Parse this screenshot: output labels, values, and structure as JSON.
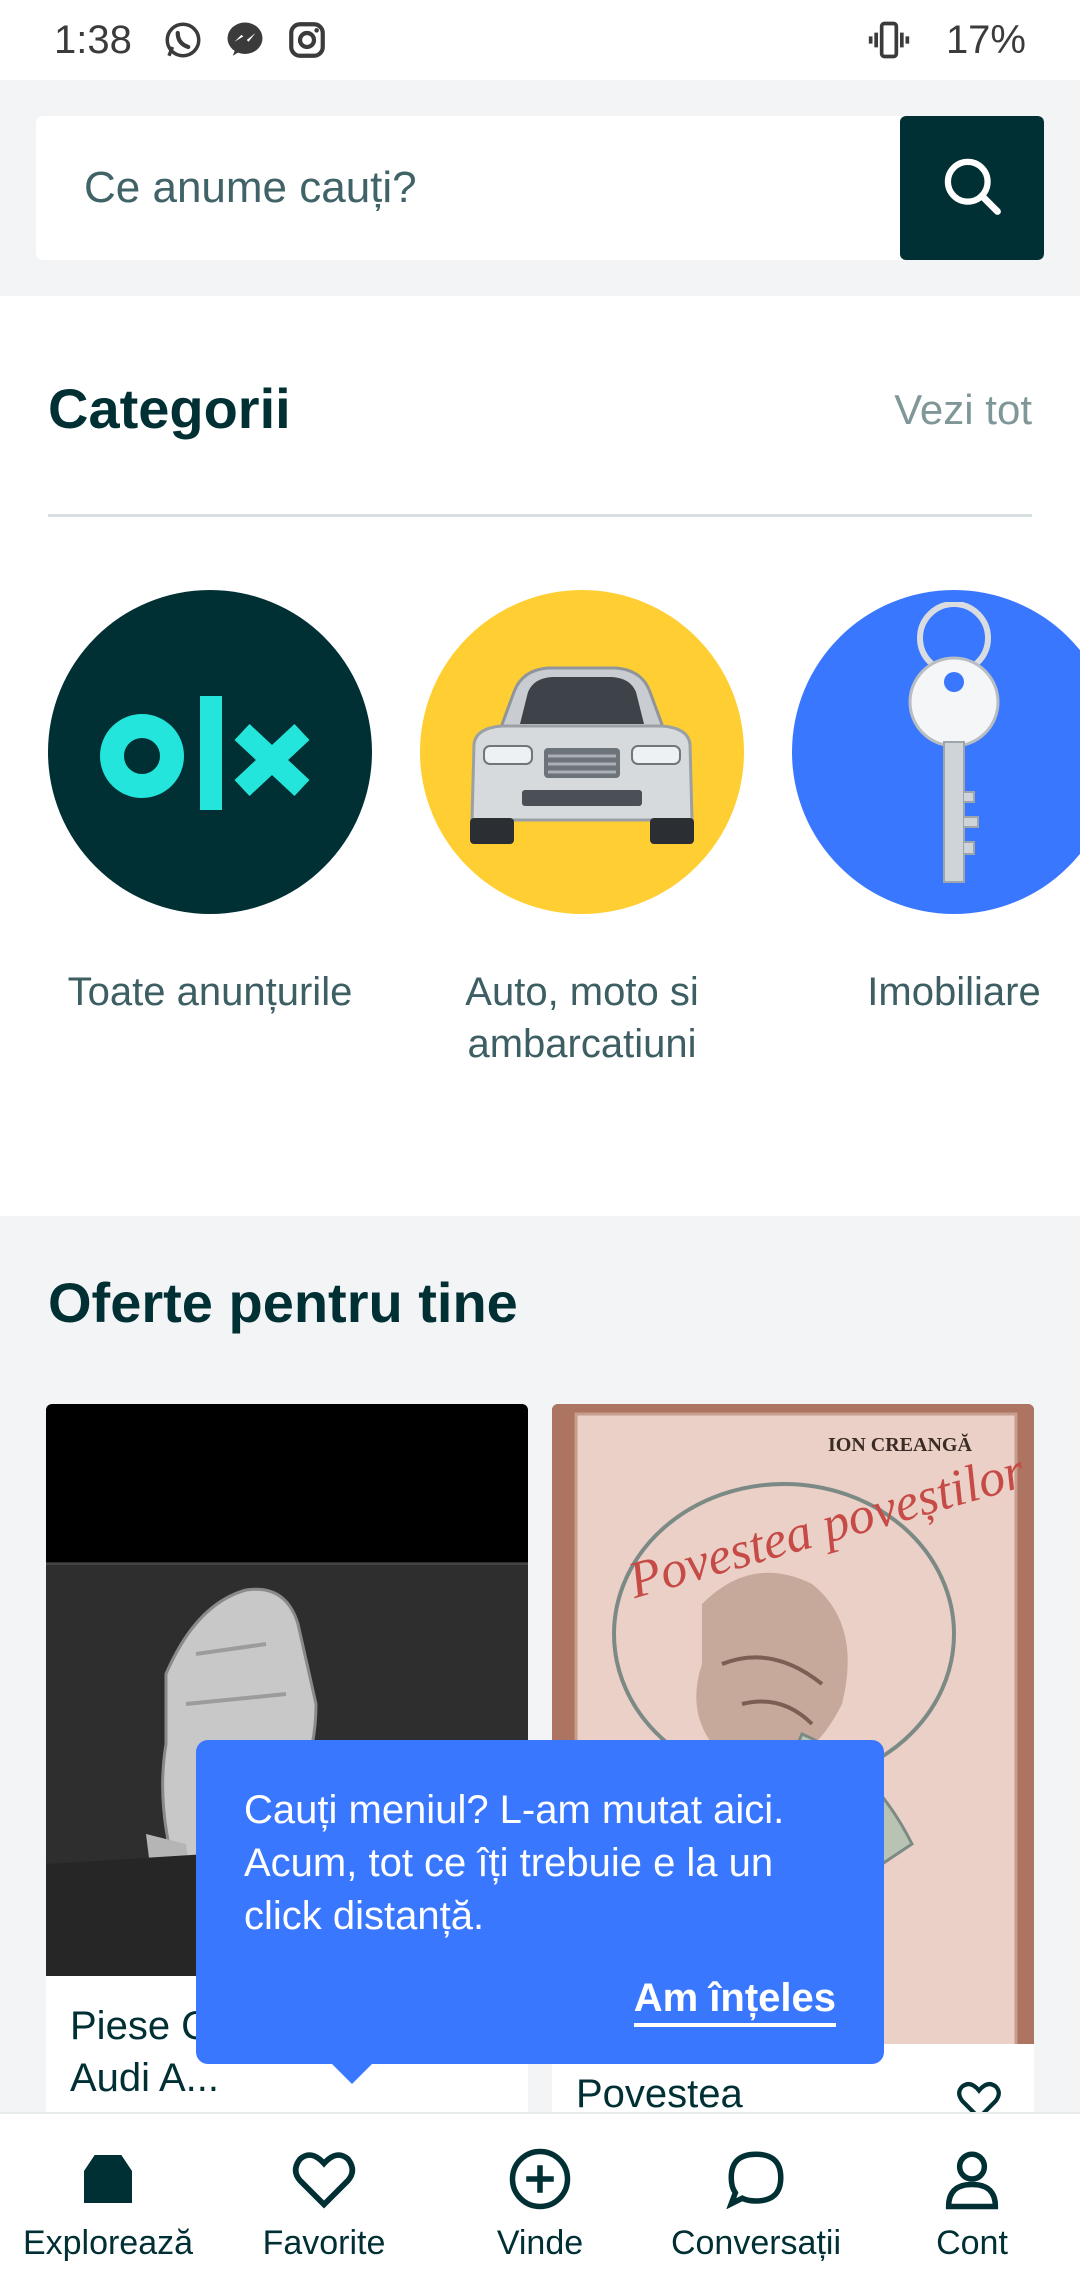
{
  "status_bar": {
    "time": "1:38",
    "battery": "17%",
    "icons": [
      "whatsapp-icon",
      "messenger-icon",
      "instagram-icon",
      "vibrate-icon"
    ]
  },
  "search": {
    "placeholder": "Ce anume cauți?",
    "button_icon": "search-icon"
  },
  "categories": {
    "title": "Categorii",
    "see_all": "Vezi tot",
    "items": [
      {
        "label": "Toate anunțurile",
        "color": "#002f34",
        "icon": "olx-logo"
      },
      {
        "label": "Auto, moto si ambarcatiuni",
        "color": "#ffce32",
        "icon": "car-image"
      },
      {
        "label": "Imobiliare",
        "color": "#3a77ff",
        "icon": "key-image"
      }
    ]
  },
  "offers": {
    "title": "Oferte pentru tine",
    "items": [
      {
        "title": "Piese Cutie automata Audi A..."
      },
      {
        "title": "Povestea"
      }
    ],
    "book_cover": {
      "author": "ION CREANGĂ",
      "title": "Povestea poveștilor"
    }
  },
  "tooltip": {
    "text": "Cauți meniul? L-am mutat aici. Acum, tot ce îți trebuie e la un click distanță.",
    "action": "Am înțeles",
    "color": "#3a77ff"
  },
  "bottom_nav": {
    "items": [
      {
        "label": "Explorează",
        "icon": "home-icon"
      },
      {
        "label": "Favorite",
        "icon": "heart-icon"
      },
      {
        "label": "Vinde",
        "icon": "plus-circle-icon"
      },
      {
        "label": "Conversații",
        "icon": "chat-icon"
      },
      {
        "label": "Cont",
        "icon": "user-icon"
      }
    ]
  },
  "colors": {
    "primary": "#002f34",
    "accent_blue": "#3a77ff",
    "accent_yellow": "#ffce32",
    "olx_teal": "#23e5db"
  }
}
